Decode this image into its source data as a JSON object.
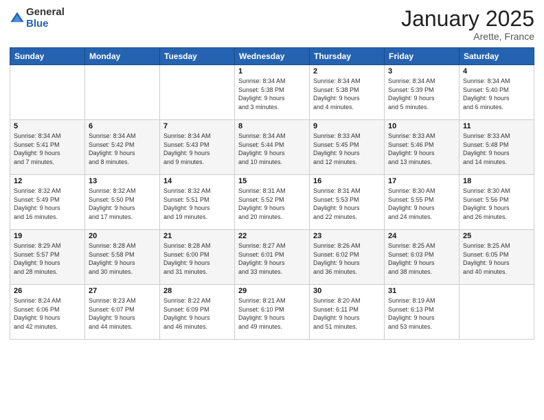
{
  "header": {
    "logo_general": "General",
    "logo_blue": "Blue",
    "title": "January 2025",
    "location": "Arette, France"
  },
  "days_of_week": [
    "Sunday",
    "Monday",
    "Tuesday",
    "Wednesday",
    "Thursday",
    "Friday",
    "Saturday"
  ],
  "weeks": [
    [
      {
        "day": "",
        "info": ""
      },
      {
        "day": "",
        "info": ""
      },
      {
        "day": "",
        "info": ""
      },
      {
        "day": "1",
        "info": "Sunrise: 8:34 AM\nSunset: 5:38 PM\nDaylight: 9 hours\nand 3 minutes."
      },
      {
        "day": "2",
        "info": "Sunrise: 8:34 AM\nSunset: 5:38 PM\nDaylight: 9 hours\nand 4 minutes."
      },
      {
        "day": "3",
        "info": "Sunrise: 8:34 AM\nSunset: 5:39 PM\nDaylight: 9 hours\nand 5 minutes."
      },
      {
        "day": "4",
        "info": "Sunrise: 8:34 AM\nSunset: 5:40 PM\nDaylight: 9 hours\nand 6 minutes."
      }
    ],
    [
      {
        "day": "5",
        "info": "Sunrise: 8:34 AM\nSunset: 5:41 PM\nDaylight: 9 hours\nand 7 minutes."
      },
      {
        "day": "6",
        "info": "Sunrise: 8:34 AM\nSunset: 5:42 PM\nDaylight: 9 hours\nand 8 minutes."
      },
      {
        "day": "7",
        "info": "Sunrise: 8:34 AM\nSunset: 5:43 PM\nDaylight: 9 hours\nand 9 minutes."
      },
      {
        "day": "8",
        "info": "Sunrise: 8:34 AM\nSunset: 5:44 PM\nDaylight: 9 hours\nand 10 minutes."
      },
      {
        "day": "9",
        "info": "Sunrise: 8:33 AM\nSunset: 5:45 PM\nDaylight: 9 hours\nand 12 minutes."
      },
      {
        "day": "10",
        "info": "Sunrise: 8:33 AM\nSunset: 5:46 PM\nDaylight: 9 hours\nand 13 minutes."
      },
      {
        "day": "11",
        "info": "Sunrise: 8:33 AM\nSunset: 5:48 PM\nDaylight: 9 hours\nand 14 minutes."
      }
    ],
    [
      {
        "day": "12",
        "info": "Sunrise: 8:32 AM\nSunset: 5:49 PM\nDaylight: 9 hours\nand 16 minutes."
      },
      {
        "day": "13",
        "info": "Sunrise: 8:32 AM\nSunset: 5:50 PM\nDaylight: 9 hours\nand 17 minutes."
      },
      {
        "day": "14",
        "info": "Sunrise: 8:32 AM\nSunset: 5:51 PM\nDaylight: 9 hours\nand 19 minutes."
      },
      {
        "day": "15",
        "info": "Sunrise: 8:31 AM\nSunset: 5:52 PM\nDaylight: 9 hours\nand 20 minutes."
      },
      {
        "day": "16",
        "info": "Sunrise: 8:31 AM\nSunset: 5:53 PM\nDaylight: 9 hours\nand 22 minutes."
      },
      {
        "day": "17",
        "info": "Sunrise: 8:30 AM\nSunset: 5:55 PM\nDaylight: 9 hours\nand 24 minutes."
      },
      {
        "day": "18",
        "info": "Sunrise: 8:30 AM\nSunset: 5:56 PM\nDaylight: 9 hours\nand 26 minutes."
      }
    ],
    [
      {
        "day": "19",
        "info": "Sunrise: 8:29 AM\nSunset: 5:57 PM\nDaylight: 9 hours\nand 28 minutes."
      },
      {
        "day": "20",
        "info": "Sunrise: 8:28 AM\nSunset: 5:58 PM\nDaylight: 9 hours\nand 30 minutes."
      },
      {
        "day": "21",
        "info": "Sunrise: 8:28 AM\nSunset: 6:00 PM\nDaylight: 9 hours\nand 31 minutes."
      },
      {
        "day": "22",
        "info": "Sunrise: 8:27 AM\nSunset: 6:01 PM\nDaylight: 9 hours\nand 33 minutes."
      },
      {
        "day": "23",
        "info": "Sunrise: 8:26 AM\nSunset: 6:02 PM\nDaylight: 9 hours\nand 36 minutes."
      },
      {
        "day": "24",
        "info": "Sunrise: 8:25 AM\nSunset: 6:03 PM\nDaylight: 9 hours\nand 38 minutes."
      },
      {
        "day": "25",
        "info": "Sunrise: 8:25 AM\nSunset: 6:05 PM\nDaylight: 9 hours\nand 40 minutes."
      }
    ],
    [
      {
        "day": "26",
        "info": "Sunrise: 8:24 AM\nSunset: 6:06 PM\nDaylight: 9 hours\nand 42 minutes."
      },
      {
        "day": "27",
        "info": "Sunrise: 8:23 AM\nSunset: 6:07 PM\nDaylight: 9 hours\nand 44 minutes."
      },
      {
        "day": "28",
        "info": "Sunrise: 8:22 AM\nSunset: 6:09 PM\nDaylight: 9 hours\nand 46 minutes."
      },
      {
        "day": "29",
        "info": "Sunrise: 8:21 AM\nSunset: 6:10 PM\nDaylight: 9 hours\nand 49 minutes."
      },
      {
        "day": "30",
        "info": "Sunrise: 8:20 AM\nSunset: 6:11 PM\nDaylight: 9 hours\nand 51 minutes."
      },
      {
        "day": "31",
        "info": "Sunrise: 8:19 AM\nSunset: 6:13 PM\nDaylight: 9 hours\nand 53 minutes."
      },
      {
        "day": "",
        "info": ""
      }
    ]
  ]
}
